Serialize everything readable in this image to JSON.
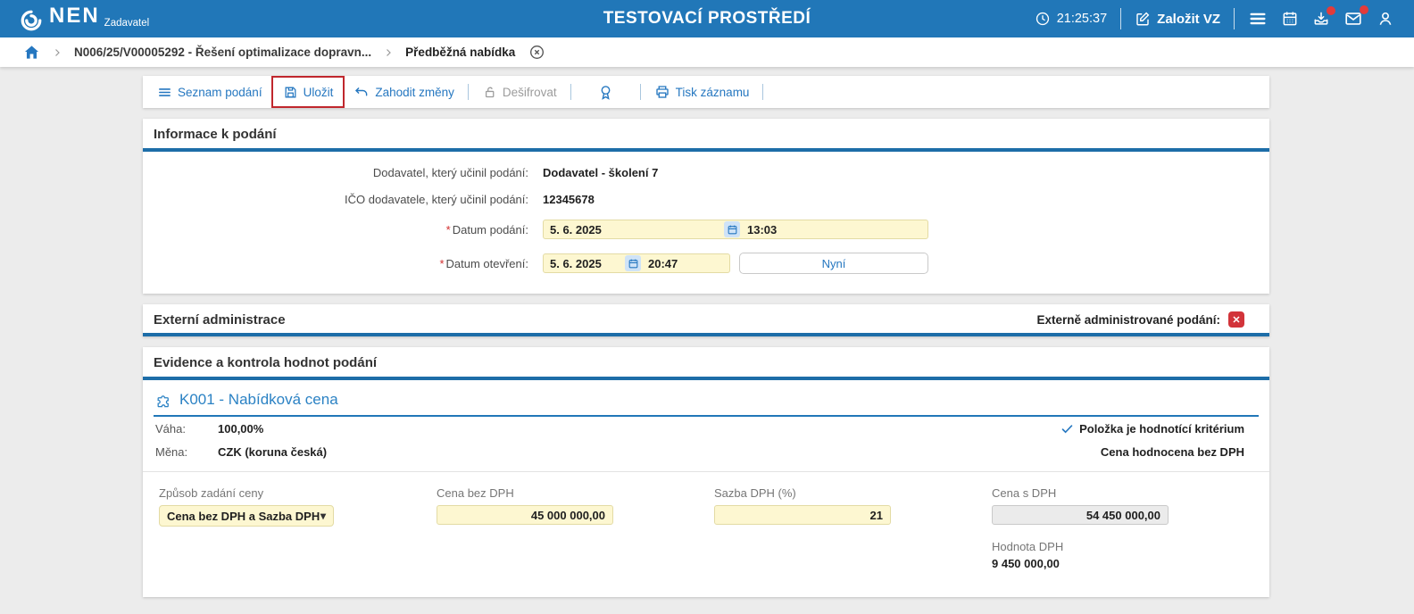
{
  "colors": {
    "header_bg": "#2177b8",
    "accent_blue": "#2577c0",
    "section_underline": "#1d6da8",
    "input_yellow_bg": "#fdf7d1",
    "input_yellow_border": "#e3dba4",
    "disabled_input_bg": "#ebebeb",
    "highlight_red": "#c0272d",
    "badge_red": "#d2343a",
    "notification_red": "#e23b3b",
    "page_bg": "#ececec"
  },
  "header": {
    "brand": "NEN",
    "brand_sub": "Zadavatel",
    "title": "TESTOVACÍ PROSTŘEDÍ",
    "time": "21:25:37",
    "create_vz_label": "Založit VZ"
  },
  "breadcrumb": {
    "procurement": "N006/25/V00005292 - Řešení optimalizace dopravn...",
    "current": "Předběžná nabídka"
  },
  "toolbar": {
    "seznam_podani": "Seznam podání",
    "ulozit": "Uložit",
    "zahodit_zmeny": "Zahodit změny",
    "desifrovat": "Dešifrovat",
    "tisk_zaznamu": "Tisk záznamu"
  },
  "info": {
    "title": "Informace k podání",
    "required_mark": "*",
    "supplier_label": "Dodavatel, který učinil podání:",
    "supplier_value": "Dodavatel - školení 7",
    "ico_label": "IČO dodavatele, který učinil podání:",
    "ico_value": "12345678",
    "datum_podani_label": "Datum podání:",
    "datum_podani_date": "5. 6. 2025",
    "datum_podani_time": "13:03",
    "datum_otevreni_label": "Datum otevření:",
    "datum_otevreni_date": "5. 6. 2025",
    "datum_otevreni_time": "20:47",
    "nyni_label": "Nyní"
  },
  "extern": {
    "title": "Externí administrace",
    "flag_label": "Externě administrované podání:"
  },
  "evidence": {
    "title": "Evidence a kontrola hodnot podání",
    "item_title": "K001 - Nabídková cena",
    "vaha_label": "Váha:",
    "vaha_value": "100,00%",
    "mena_label": "Měna:",
    "mena_value": "CZK (koruna česká)",
    "kriterium_label": "Položka je hodnotící kritérium",
    "hodnocena_label": "Cena hodnocena bez DPH",
    "zpusob_label": "Způsob zadání ceny",
    "zpusob_value": "Cena bez DPH a Sazba DPH",
    "cena_bez_dph_label": "Cena bez DPH",
    "cena_bez_dph_value": "45 000 000,00",
    "sazba_dph_label": "Sazba DPH (%)",
    "sazba_dph_value": "21",
    "cena_s_dph_label": "Cena s DPH",
    "cena_s_dph_value": "54 450 000,00",
    "hodnota_dph_label": "Hodnota DPH",
    "hodnota_dph_value": "9 450 000,00"
  },
  "icons": {
    "nen-logo-icon": "swirl-ring",
    "clock-icon": "clock",
    "edit-icon": "pencil-square",
    "menu-icon": "hamburger",
    "calendar-icon": "calendar",
    "inbox-download-icon": "tray-arrow-down",
    "mail-icon": "envelope",
    "user-icon": "person",
    "home-icon": "house",
    "chevron-right-icon": "›",
    "close-circle-icon": "circled-x",
    "list-icon": "≡",
    "save-icon": "floppy-disk",
    "undo-icon": "curved-arrow-left",
    "unlock-icon": "open-padlock",
    "seal-icon": "award-ribbon",
    "printer-icon": "printer",
    "calendar-field-icon": "calendar",
    "chevron-down-icon": "▾",
    "check-icon": "✓",
    "cross-badge-icon": "✕"
  }
}
